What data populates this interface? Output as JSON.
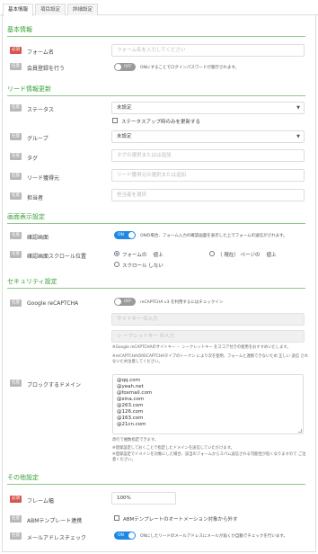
{
  "tabs": [
    "基本情報",
    "項目設定",
    "詳細設定"
  ],
  "sections": {
    "basic": "基本情報",
    "lead": "リード情報更新",
    "display": "画面表示設定",
    "security": "セキュリティ設定",
    "other": "その他設定"
  },
  "badges": {
    "required": "必須",
    "optional": "任意"
  },
  "form_name": {
    "label": "フォーム名",
    "placeholder": "フォーム名を入力してください"
  },
  "member": {
    "label": "会員登録を行う",
    "toggle": "OFF",
    "note": "ONにすることでログインパスワードが発行されます。"
  },
  "status": {
    "label": "ステータス",
    "value": "未設定",
    "checkbox_label": "ステータスアップ時のみを更新する"
  },
  "group": {
    "label": "グループ",
    "value": "未設定"
  },
  "tag": {
    "label": "タグ",
    "placeholder": "タグの選択またはは追加"
  },
  "lead_source": {
    "label": "リード獲得元",
    "placeholder": "リード獲得元の選択または追加"
  },
  "owner": {
    "label": "担当者",
    "placeholder": "担当者を選択"
  },
  "auto_scroll": {
    "label": "確認画面",
    "toggle": "ON",
    "note": "ONの場合、フォーム入力の確認画面を表示した上でフォームの送信がされます。"
  },
  "scroll_pos": {
    "label": "確認画面スクロール位置",
    "options": [
      "フォームの　 値上",
      "（ 現在） ページの　 値上",
      "スクロール しない"
    ]
  },
  "recaptcha": {
    "label": "Google reCAPTCHA",
    "toggle": "OFF",
    "note": "reCAPTCHA v3 を利用するにはチェックイン",
    "site_key": "サイトキー の入力",
    "secret_key": "シ ークレットキー の入力",
    "help1": "※Google reCAPTCHAのサイトキー ・ シークレットキー をスコア付きの使用をおすすめいたします。",
    "help2": "※reCAPTCHAのRECAPTCHAタイプのトークン により次を使用、フォームと連携できないため 正しい 送信 されないため注意してください。"
  },
  "block_domain": {
    "label": "ブロックするドメイン",
    "domains": [
      "@qq.com",
      "@yeah.net",
      "@foxmail.com",
      "@sina.com",
      "@263.com",
      "@126.com",
      "@163.com",
      "@21cn.com"
    ],
    "help1": "改行で複数指定できます。",
    "help2": "※登録設定しておくことで指定したドメインを送信していただけます。",
    "help3": "※登録設定でドメインを対象にした場合、該当のフォームからスパム送信される可能性が低くなりますので ご注意ください。"
  },
  "frame_width": {
    "label": "フレーム幅",
    "value": "100%"
  },
  "abm": {
    "label": "ABMテンプレート連携",
    "checkbox_label": "ABMテンプレートのオートメーション対象から外す"
  },
  "mail_check": {
    "label": "メールアドレスチェック",
    "toggle": "ON",
    "note": "ONにしたリードのメールアドレスにメールが届くか自動でチェックを行います。"
  },
  "colors": {
    "accent": "#38a136",
    "required": "#d9534f",
    "toggle_on": "#1e88e5",
    "toggle_off": "#9a9a9a"
  }
}
